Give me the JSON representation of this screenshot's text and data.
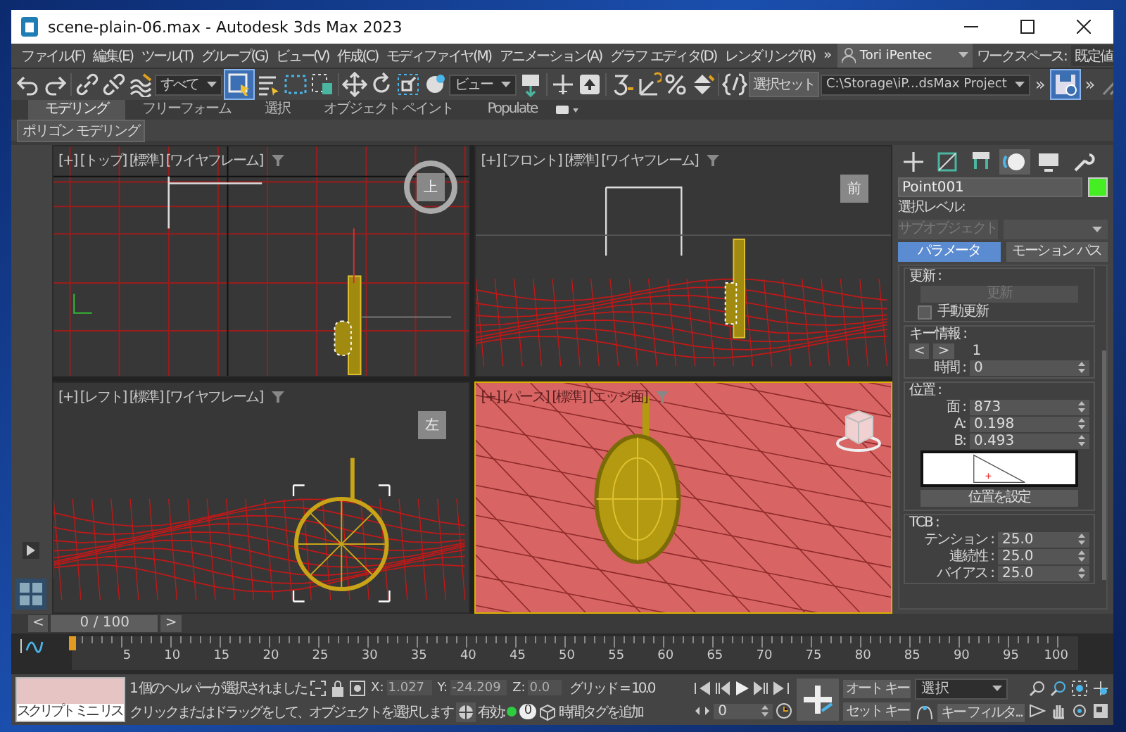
{
  "window": {
    "title": "scene-plain-06.max - Autodesk 3ds Max 2023"
  },
  "menu": {
    "items": [
      "ファイル(F)",
      "編集(E)",
      "ツール(T)",
      "グループ(G)",
      "ビュー(V)",
      "作成(C)",
      "モディファイヤ(M)",
      "アニメーション(A)",
      "グラフ エディタ(D)",
      "レンダリング(R)"
    ],
    "more": "»"
  },
  "user": "Tori iPentec",
  "workspace": {
    "label": "ワークスペース:",
    "value": "既定値"
  },
  "toolbar": {
    "selection_filter": "すべて",
    "select_object_selected": true,
    "reference_coord": "ビュー",
    "named_selection": "選択セット",
    "project_path": "C:\\Storage\\iP...dsMax Project",
    "more": [
      "»",
      "»"
    ]
  },
  "ribbon": {
    "tabs": [
      {
        "label": "モデリング",
        "selected": true
      },
      {
        "label": "フリーフォーム",
        "selected": false
      },
      {
        "label": "選択",
        "selected": false
      },
      {
        "label": "オブジェクト ペイント",
        "selected": false
      },
      {
        "label": "Populate",
        "selected": false
      }
    ],
    "panel": "ポリゴン モデリング"
  },
  "viewports": [
    {
      "kind": "top",
      "label": "[+] [トップ] [標準] [ワイヤフレーム]",
      "viewcube": "上",
      "selected": false
    },
    {
      "kind": "front",
      "label": "[+] [フロント] [標準] [ワイヤフレーム]",
      "viewcube": "前",
      "selected": false
    },
    {
      "kind": "left",
      "label": "[+] [レフト] [標準] [ワイヤフレーム]",
      "viewcube": "左",
      "selected": false
    },
    {
      "kind": "perspective",
      "label": "[+] [パース] [標準] [エッジ面]",
      "selected": true
    }
  ],
  "command_panel": {
    "tabs": [
      {
        "selected": false
      },
      {
        "selected": false
      },
      {
        "selected": false
      },
      {
        "selected": true
      },
      {
        "selected": false
      },
      {
        "selected": false
      }
    ],
    "object": {
      "name": "Point001",
      "color": "#44ee22"
    },
    "selection_level_label": "選択レベル:",
    "subobject_button": {
      "label": "サブオブジェクト",
      "disabled": true
    },
    "mode_buttons": [
      {
        "label": "パラメータ",
        "selected": true
      },
      {
        "label": "モーション パス",
        "selected": false
      }
    ],
    "update_group": {
      "title": "更新 :",
      "button": {
        "label": "更新",
        "disabled": true
      },
      "manual_update": {
        "label": "手動更新",
        "checked": false
      }
    },
    "key_info": {
      "title": "キー情報 :",
      "prev": "<",
      "next": ">",
      "key_number": "1",
      "time_label": "時間 :",
      "time_value": "0"
    },
    "position": {
      "title": "位置 :",
      "fields": [
        {
          "label": "面 :",
          "value": "873"
        },
        {
          "label": "A:",
          "value": "0.198"
        },
        {
          "label": "B:",
          "value": "0.493"
        }
      ],
      "set_button": "位置を設定"
    },
    "tcb": {
      "title": "TCB :",
      "fields": [
        {
          "label": "テンション :",
          "value": "25.0"
        },
        {
          "label": "連続性 :",
          "value": "25.0"
        },
        {
          "label": "バイアス :",
          "value": "25.0"
        }
      ]
    }
  },
  "time_slider": {
    "prev": "<",
    "position": "0 / 100",
    "next": ">"
  },
  "track_bar": {
    "labels": [
      "5",
      "10",
      "15",
      "20",
      "25",
      "30",
      "35",
      "40",
      "45",
      "50",
      "55",
      "60",
      "65",
      "70",
      "75",
      "80",
      "85",
      "90",
      "95",
      "100"
    ]
  },
  "status": {
    "mini_listener": "スクリプト ミニ リス",
    "message": "1 個のヘルパーが選択されました",
    "prompt": "クリックまたはドラッグをして、オブジェクトを選択します",
    "coords": [
      {
        "label": "X:",
        "value": "1.027"
      },
      {
        "label": "Y:",
        "value": "-24.209"
      },
      {
        "label": "Z:",
        "value": "0.0"
      }
    ],
    "grid": "グリッド = 10.0",
    "enabled_label": "有効:",
    "enabled_on": true,
    "tag_count": "0",
    "add_time_tag": "時間タグを追加",
    "frame_value": "0",
    "auto_key": "オート キー",
    "set_key": "セット キー",
    "key_set": "選択",
    "key_filters": "キー フィルタ..."
  }
}
